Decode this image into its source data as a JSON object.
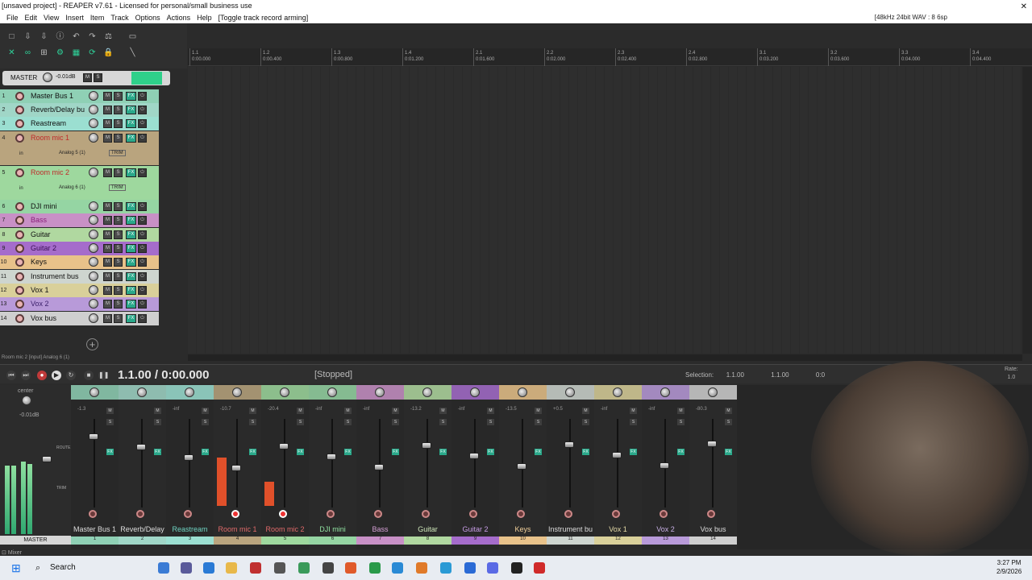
{
  "title": "[unsaved project] - REAPER v7.61 - Licensed for personal/small business use",
  "menu": [
    "File",
    "Edit",
    "View",
    "Insert",
    "Item",
    "Track",
    "Options",
    "Actions",
    "Help",
    "[Toggle track record arming]"
  ],
  "status_right": "[48kHz 24bit WAV : 8",
  "status_right_tail": "6sp",
  "ruler": [
    {
      "bar": "1.1",
      "time": "0:00.000"
    },
    {
      "bar": "1.2",
      "time": "0:00.400"
    },
    {
      "bar": "1.3",
      "time": "0:00.800"
    },
    {
      "bar": "1.4",
      "time": "0:01.200"
    },
    {
      "bar": "2.1",
      "time": "0:01.600"
    },
    {
      "bar": "2.2",
      "time": "0:02.000"
    },
    {
      "bar": "2.3",
      "time": "0:02.400"
    },
    {
      "bar": "2.4",
      "time": "0:02.800"
    },
    {
      "bar": "3.1",
      "time": "0:03.200"
    },
    {
      "bar": "3.2",
      "time": "0:03.600"
    },
    {
      "bar": "3.3",
      "time": "0:04.000"
    },
    {
      "bar": "3.4",
      "time": "0:04.400"
    }
  ],
  "master": {
    "label": "MASTER",
    "vol": "-0.01dB"
  },
  "tracks": [
    {
      "num": "1",
      "name": "Master Bus 1",
      "color": "#8fd0b5",
      "text": "#111"
    },
    {
      "num": "2",
      "name": "Reverb/Delay bu",
      "color": "#a0d6c7",
      "text": "#111"
    },
    {
      "num": "3",
      "name": "Reastream",
      "color": "#9bdfd1",
      "text": "#111"
    },
    {
      "num": "4",
      "name": "Room mic 1",
      "color": "#b9a47e",
      "text": "#c02a2a"
    },
    {
      "num": "5",
      "name": "Room mic 2",
      "color": "#9ed89e",
      "text": "#c02a2a"
    },
    {
      "num": "6",
      "name": "DJI mini",
      "color": "#95d5a3",
      "text": "#111"
    },
    {
      "num": "7",
      "name": "Bass",
      "color": "#c890c6",
      "text": "#8a1f7a"
    },
    {
      "num": "8",
      "name": "Guitar",
      "color": "#b0d8a0",
      "text": "#111"
    },
    {
      "num": "9",
      "name": "Guitar 2",
      "color": "#a56ccb",
      "text": "#3a0f55"
    },
    {
      "num": "10",
      "name": "Keys",
      "color": "#e8c28a",
      "text": "#111"
    },
    {
      "num": "11",
      "name": "Instrument bus",
      "color": "#ced5cf",
      "text": "#111"
    },
    {
      "num": "12",
      "name": "Vox 1",
      "color": "#d9d09a",
      "text": "#111"
    },
    {
      "num": "13",
      "name": "Vox 2",
      "color": "#b89ad9",
      "text": "#3a1f6a"
    },
    {
      "num": "14",
      "name": "Vox bus",
      "color": "#cfcfcf",
      "text": "#111"
    }
  ],
  "room_inputs": [
    "Analog 5 (1)",
    "Analog 6 (1)"
  ],
  "trim_label": "TRIM",
  "in_label": "in",
  "add_track": "+",
  "status_info": "Room mic 2 [input] Analog 6 (1)",
  "transport": {
    "time": "1.1.00 / 0:00.000",
    "state": "[Stopped]",
    "selection_label": "Selection:",
    "sel_start": "1.1.00",
    "sel_end": "1.1.00",
    "sel_len": "0:0",
    "rate_label": "Rate:",
    "rate": "1.0"
  },
  "mixer": {
    "master_label": "MASTER",
    "center": "center",
    "master_vol": "-0.01dB",
    "route": "ROUTE",
    "trim": "TRIM",
    "strips": [
      {
        "label": "Master Bus 1",
        "num": "1",
        "color": "#8fd0b5",
        "lbl_color": "#ddd",
        "db": "-1.3"
      },
      {
        "label": "Reverb/Delay",
        "num": "2",
        "color": "#a0d6c7",
        "lbl_color": "#ddd",
        "db": ""
      },
      {
        "label": "Reastream",
        "num": "3",
        "color": "#9bdfd1",
        "lbl_color": "#6fd4c3",
        "db": "-inf"
      },
      {
        "label": "Room mic 1",
        "num": "4",
        "color": "#b9a47e",
        "lbl_color": "#e06a6a",
        "db": "-10.7"
      },
      {
        "label": "Room mic 2",
        "num": "5",
        "color": "#9ed89e",
        "lbl_color": "#e06a6a",
        "db": "-20.4"
      },
      {
        "label": "DJI mini",
        "num": "6",
        "color": "#95d5a3",
        "lbl_color": "#8fe0a0",
        "db": "-inf"
      },
      {
        "label": "Bass",
        "num": "7",
        "color": "#c890c6",
        "lbl_color": "#d6a0d6",
        "db": "-inf"
      },
      {
        "label": "Guitar",
        "num": "8",
        "color": "#b0d8a0",
        "lbl_color": "#cde6b8",
        "db": "-13.2"
      },
      {
        "label": "Guitar 2",
        "num": "9",
        "color": "#a56ccb",
        "lbl_color": "#c79ce6",
        "db": "-inf"
      },
      {
        "label": "Keys",
        "num": "10",
        "color": "#e8c28a",
        "lbl_color": "#f0cf9a",
        "db": "-13.5"
      },
      {
        "label": "Instrument bu",
        "num": "11",
        "color": "#ced5cf",
        "lbl_color": "#ddd",
        "db": "+0.5"
      },
      {
        "label": "Vox 1",
        "num": "12",
        "color": "#d9d09a",
        "lbl_color": "#e6dca8",
        "db": "-inf"
      },
      {
        "label": "Vox 2",
        "num": "13",
        "color": "#b89ad9",
        "lbl_color": "#c8b0e6",
        "db": "-inf"
      },
      {
        "label": "Vox bus",
        "num": "14",
        "color": "#cfcfcf",
        "lbl_color": "#ddd",
        "db": "-80.3"
      }
    ]
  },
  "mixer_tab": "Mixer",
  "taskbar": {
    "search": "Search",
    "time": "3:27 PM",
    "date": "2/9/2026"
  }
}
